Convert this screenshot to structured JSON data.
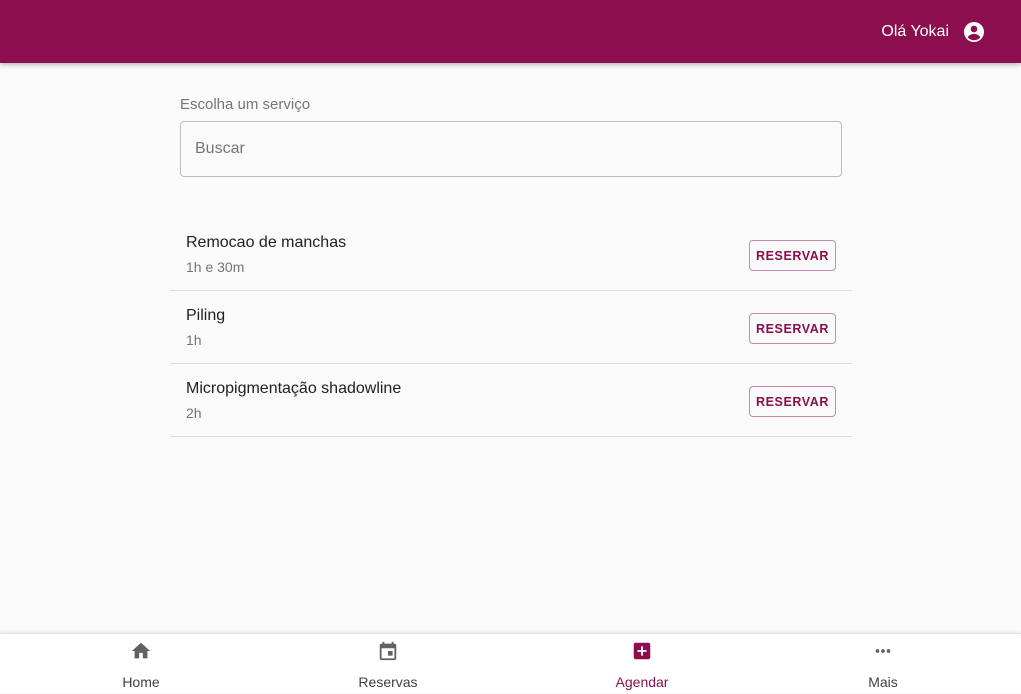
{
  "header": {
    "greeting": "Olá Yokai",
    "account_icon": "account-circle-icon",
    "background_color": "#8b0e4e"
  },
  "search": {
    "label": "Escolha um serviço",
    "placeholder": "Buscar",
    "value": ""
  },
  "services": [
    {
      "name": "Remocao de manchas",
      "duration": "1h e 30m",
      "action_label": "RESERVAR"
    },
    {
      "name": "Piling",
      "duration": "1h",
      "action_label": "RESERVAR"
    },
    {
      "name": "Micropigmentação shadowline",
      "duration": "2h",
      "action_label": "RESERVAR"
    }
  ],
  "bottom_nav": {
    "active": "Agendar",
    "accent_color": "#8b0e4e",
    "items": [
      {
        "label": "Home",
        "icon": "home-icon"
      },
      {
        "label": "Reservas",
        "icon": "calendar-icon"
      },
      {
        "label": "Agendar",
        "icon": "add-box-icon"
      },
      {
        "label": "Mais",
        "icon": "more-horizontal-icon"
      }
    ]
  }
}
